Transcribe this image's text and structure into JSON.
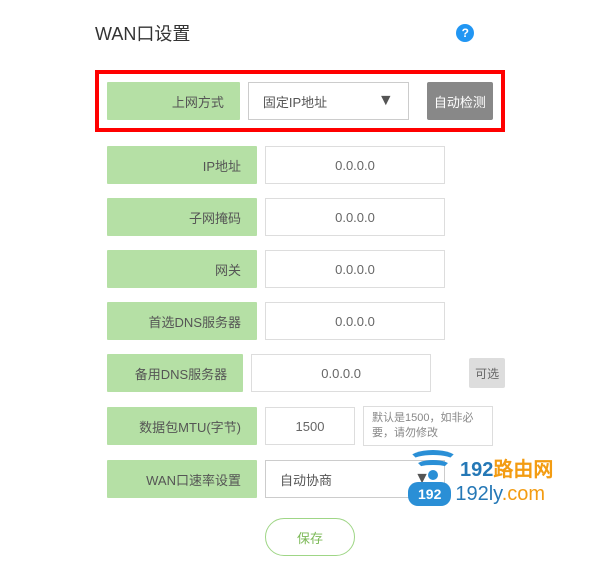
{
  "header": {
    "title": "WAN口设置",
    "help_icon": "?"
  },
  "connection": {
    "label": "上网方式",
    "value": "固定IP地址",
    "detect_button": "自动检测"
  },
  "fields": {
    "ip": {
      "label": "IP地址",
      "value": "0.0.0.0"
    },
    "subnet": {
      "label": "子网掩码",
      "value": "0.0.0.0"
    },
    "gateway": {
      "label": "网关",
      "value": "0.0.0.0"
    },
    "dns1": {
      "label": "首选DNS服务器",
      "value": "0.0.0.0"
    },
    "dns2": {
      "label": "备用DNS服务器",
      "value": "0.0.0.0",
      "optional_tag": "可选"
    },
    "mtu": {
      "label": "数据包MTU(字节)",
      "value": "1500",
      "hint": "默认是1500，如非必要，请勿修改"
    },
    "speed": {
      "label": "WAN口速率设置",
      "value": "自动协商"
    }
  },
  "save_button": "保存",
  "watermark": {
    "badge": "192",
    "line1_a": "192",
    "line1_b": "路由网",
    "line2_a": "192ly",
    "line2_b": ".com"
  }
}
